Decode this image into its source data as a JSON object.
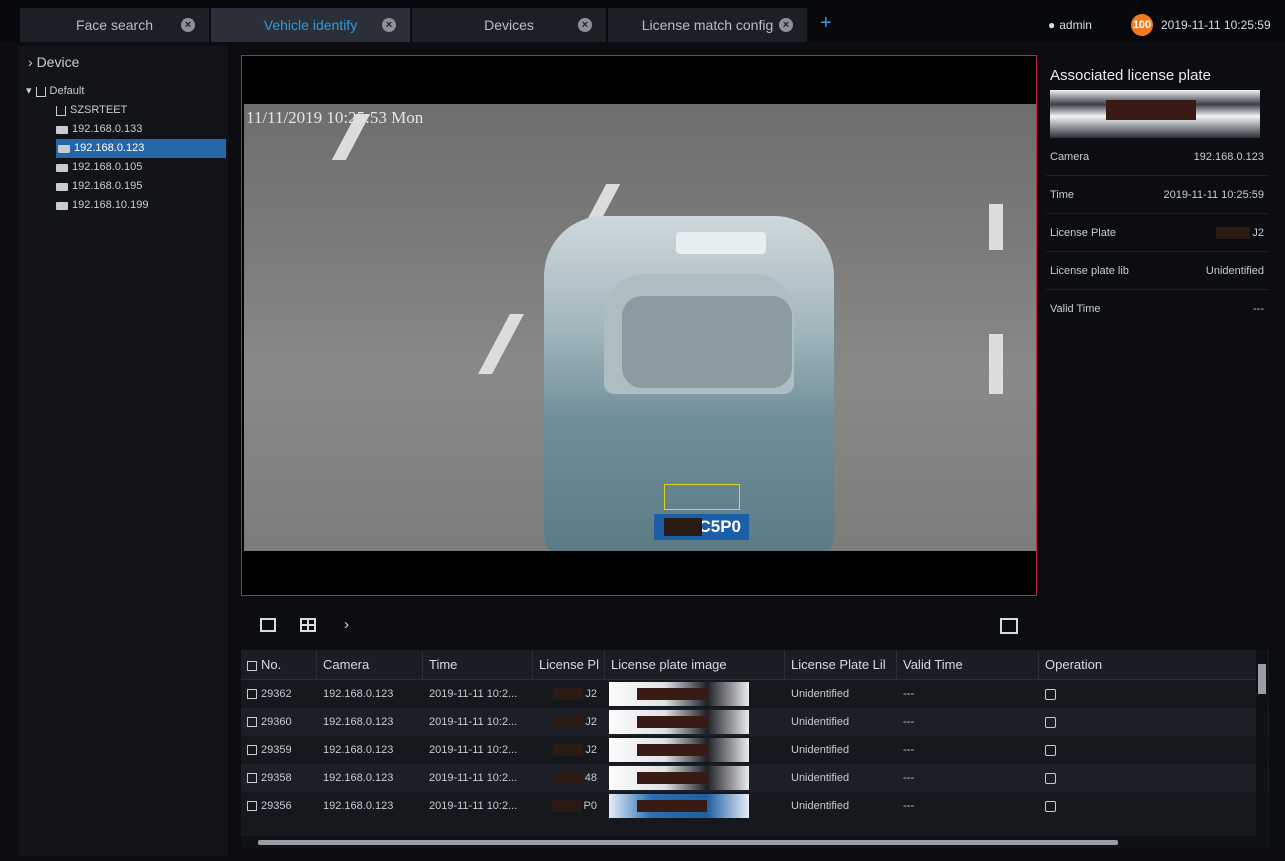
{
  "tabs": [
    {
      "label": "Face search",
      "active": false
    },
    {
      "label": "Vehicle identify",
      "active": true
    },
    {
      "label": "Devices",
      "active": false
    },
    {
      "label": "License match config",
      "active": false
    }
  ],
  "tab_add_glyph": "+",
  "user": {
    "name": "admin",
    "alarm_count": "100"
  },
  "clock": "2019-11-11 10:25:59",
  "tree": {
    "header": "Device",
    "group": "Default",
    "nodes": [
      {
        "label": "SZSRTEET",
        "icon": "network-icon"
      },
      {
        "label": "192.168.0.133",
        "icon": "camera-icon"
      },
      {
        "label": "192.168.0.123",
        "icon": "camera-icon",
        "selected": true
      },
      {
        "label": "192.168.0.105",
        "icon": "camera-icon"
      },
      {
        "label": "192.168.0.195",
        "icon": "camera-icon"
      },
      {
        "label": "192.168.10.199",
        "icon": "camera-icon"
      }
    ]
  },
  "video": {
    "osd": "11/11/2019 10:25:53 Mon",
    "plate_text": "C5P0"
  },
  "panel": {
    "title": "Associated license plate",
    "rows": [
      {
        "label": "Camera",
        "value": "192.168.0.123"
      },
      {
        "label": "Time",
        "value": "2019-11-11 10:25:59"
      },
      {
        "label": "License Plate",
        "value": "J2"
      },
      {
        "label": "License plate lib",
        "value": "Unidentified"
      },
      {
        "label": "Valid Time",
        "value": "---"
      }
    ]
  },
  "table": {
    "headers": [
      "No.",
      "Camera",
      "Time",
      "License Pl",
      "License plate image",
      "License Plate Lil",
      "Valid Time",
      "Operation"
    ],
    "rows": [
      {
        "no": "29362",
        "camera": "192.168.0.123",
        "time": "2019-11-11 10:2...",
        "plate": "J2",
        "lib": "Unidentified",
        "valid": "---"
      },
      {
        "no": "29360",
        "camera": "192.168.0.123",
        "time": "2019-11-11 10:2...",
        "plate": "J2",
        "lib": "Unidentified",
        "valid": "---"
      },
      {
        "no": "29359",
        "camera": "192.168.0.123",
        "time": "2019-11-11 10:2...",
        "plate": "J2",
        "lib": "Unidentified",
        "valid": "---"
      },
      {
        "no": "29358",
        "camera": "192.168.0.123",
        "time": "2019-11-11 10:2...",
        "plate": "48",
        "lib": "Unidentified",
        "valid": "---"
      },
      {
        "no": "29356",
        "camera": "192.168.0.123",
        "time": "2019-11-11 10:2...",
        "plate": "P0",
        "lib": "Unidentified",
        "valid": "---"
      }
    ]
  }
}
